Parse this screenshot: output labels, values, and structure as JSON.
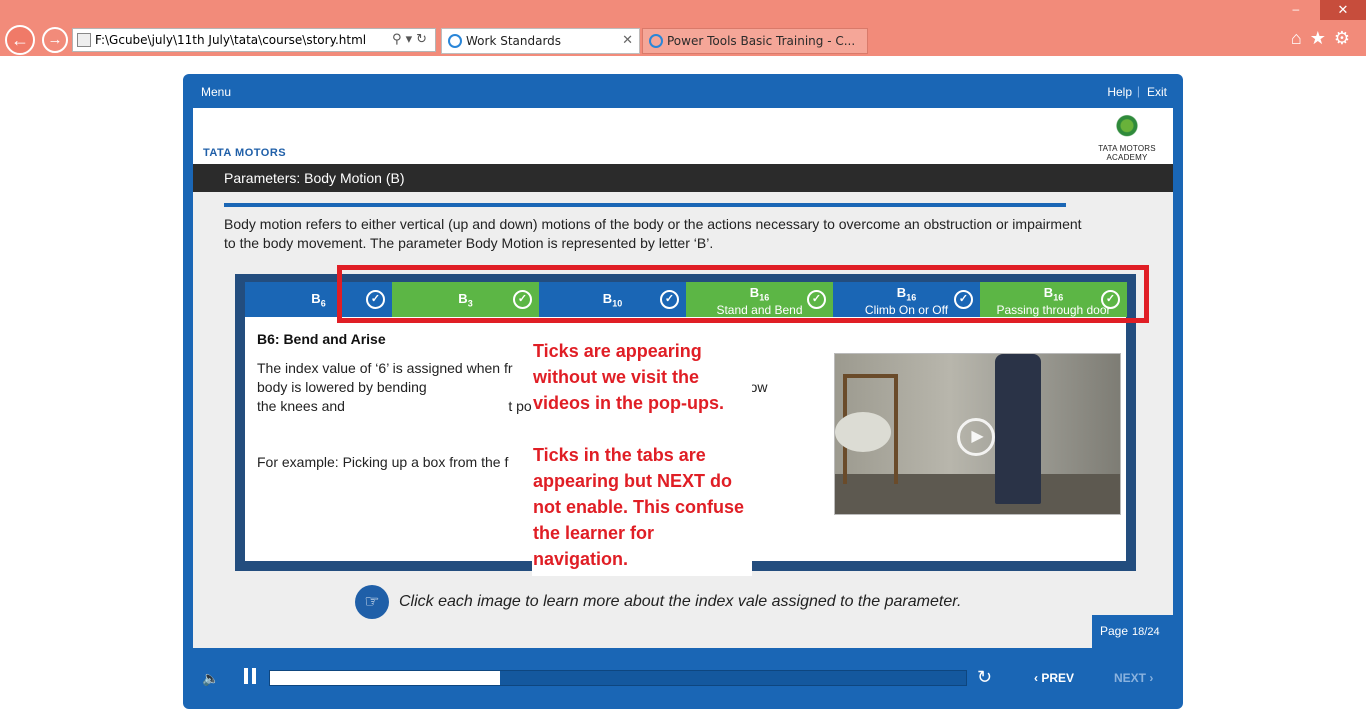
{
  "browser": {
    "address": "F:\\Gcube\\july\\11th July\\tata\\course\\story.html",
    "tabs": [
      {
        "title": "Work Standards",
        "active": true
      },
      {
        "title": "Power Tools Basic Training - C...",
        "active": false
      }
    ]
  },
  "player": {
    "menu_label": "Menu",
    "help_label": "Help",
    "separator": "|",
    "exit_label": "Exit",
    "brand_left": "TATA MOTORS",
    "brand_right": "TATA MOTORS ACADEMY",
    "title": "Parameters: Body Motion (B)",
    "intro": "Body motion refers to either vertical (up and down) motions of the body or the actions necessary to overcome an obstruction or impairment to the body movement. The parameter Body Motion is represented by letter ‘B’.",
    "tabs": [
      {
        "main": "B",
        "sub_index": "6",
        "caption": "",
        "color": "blue",
        "checked": true
      },
      {
        "main": "B",
        "sub_index": "3",
        "caption": "",
        "color": "green",
        "checked": true
      },
      {
        "main": "B",
        "sub_index": "10",
        "caption": "",
        "color": "blue",
        "checked": true
      },
      {
        "main": "B",
        "sub_index": "16",
        "caption": "Stand and Bend",
        "color": "green",
        "checked": true
      },
      {
        "main": "B",
        "sub_index": "16",
        "caption": "Climb On or Off",
        "color": "blue",
        "checked": true
      },
      {
        "main": "B",
        "sub_index": "16",
        "caption": "Passing through door",
        "color": "green",
        "checked": true
      }
    ],
    "panel": {
      "heading": "B6: Bend and Arise",
      "body": "The index value of ‘6’ is assigned when fr                                        e trunk of the body is lowered by bending                                         low the hands to reach below the knees and                                          t position.",
      "example": "For example: Picking up a box from the f"
    },
    "annotation": {
      "note_1": "Ticks are appearing without we visit the videos in the pop-ups.",
      "note_2": "Ticks in the tabs are appearing but NEXT do not enable. This confuse the learner for navigation."
    },
    "hint": "Click each image to learn more about the index vale assigned to the parameter.",
    "page_label": "Page",
    "page_number": "18/24",
    "progress": 0.33,
    "prev_label": "PREV",
    "next_label": "NEXT",
    "next_enabled": false
  },
  "colors": {
    "chrome": "#f28b7a",
    "player_blue": "#1a66b5",
    "tab_green": "#5cb645",
    "board_dark": "#234d7e",
    "annotation_red": "#e01e25"
  },
  "icons": [
    "back-arrow-icon",
    "forward-arrow-icon",
    "search-icon",
    "refresh-icon",
    "ie-icon",
    "close-icon",
    "home-icon",
    "star-icon",
    "gear-icon",
    "check-icon",
    "play-icon",
    "hand-pointer-icon",
    "volume-icon",
    "pause-icon",
    "replay-icon",
    "chevron-left-icon",
    "chevron-right-icon"
  ]
}
